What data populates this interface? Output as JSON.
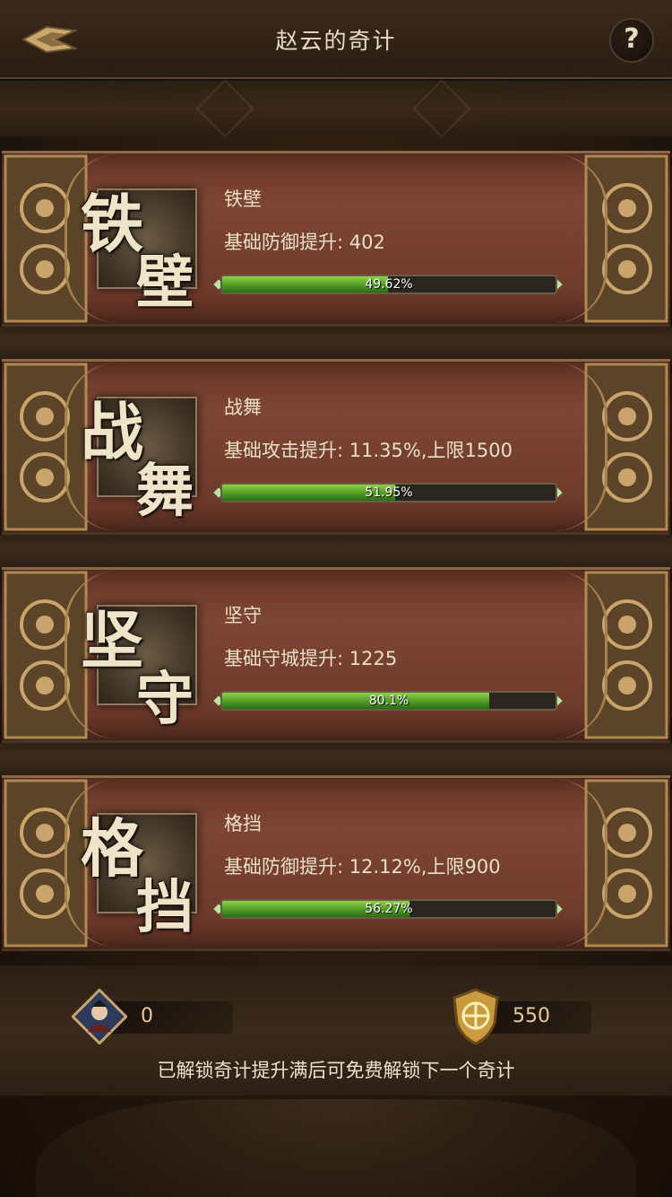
{
  "header": {
    "title": "赵云的奇计",
    "help_label": "?"
  },
  "skills": [
    {
      "glyph1": "铁",
      "glyph2": "壁",
      "name": "铁壁",
      "desc": "基础防御提升: 402",
      "progress_text": "49.62%",
      "progress": 0.4962
    },
    {
      "glyph1": "战",
      "glyph2": "舞",
      "name": "战舞",
      "desc": "基础攻击提升: 11.35%,上限1500",
      "progress_text": "51.95%",
      "progress": 0.5195
    },
    {
      "glyph1": "坚",
      "glyph2": "守",
      "name": "坚守",
      "desc": "基础守城提升: 1225",
      "progress_text": "80.1%",
      "progress": 0.801
    },
    {
      "glyph1": "格",
      "glyph2": "挡",
      "name": "格挡",
      "desc": "基础防御提升: 12.12%,上限900",
      "progress_text": "56.27%",
      "progress": 0.5627
    }
  ],
  "resources": {
    "hero_token_count": "0",
    "shield_count": "550"
  },
  "hint": "已解锁奇计提升满后可免费解锁下一个奇计",
  "colors": {
    "card_red": "#7d4534",
    "gold": "#a7824f",
    "bar_green": "#4f9a25",
    "text_cream": "#eadfc8"
  }
}
